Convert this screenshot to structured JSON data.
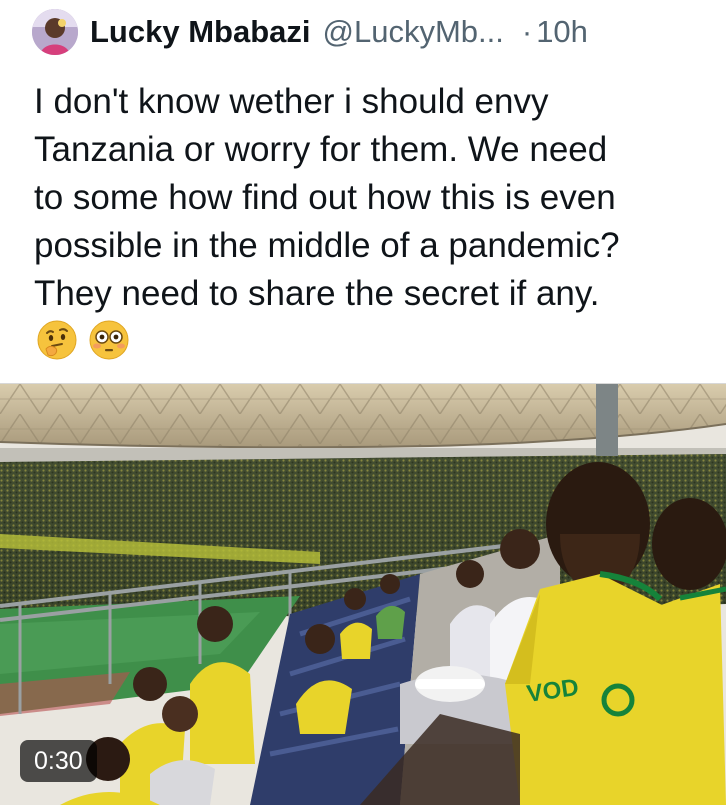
{
  "tweet": {
    "author_name": "Lucky Mbabazi",
    "author_handle": "@LuckyMb...",
    "separator": "·",
    "timestamp": "10h",
    "text": "I don't know wether i should envy\nTanzania or worry for them. We need\nto some how find out how this is even\npossible in the middle of a pandemic?\nThey need to share the secret if any.",
    "emojis": [
      "thinking-face-emoji",
      "flushed-face-emoji"
    ]
  },
  "media": {
    "type": "video",
    "duration": "0:30",
    "jersey_text": "VOD",
    "colors": {
      "jersey_yellow": "#e8d42a",
      "jersey_green": "#16833a",
      "roof_beige": "#c9b896",
      "pitch_green": "#3f8f4a"
    }
  },
  "colors": {
    "text_primary": "#0f1419",
    "text_secondary": "#536471"
  }
}
